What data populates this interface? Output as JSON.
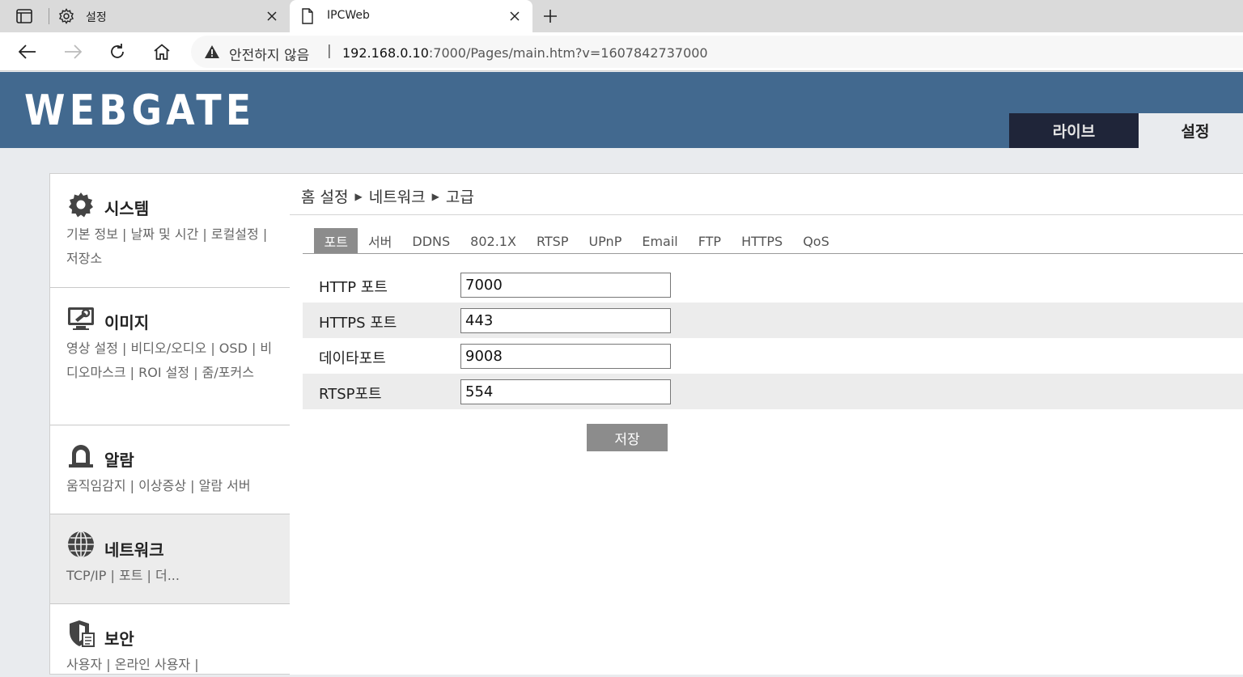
{
  "browser": {
    "tabs": [
      {
        "title": "설정",
        "icon": "gear-icon"
      },
      {
        "title": "IPCWeb",
        "icon": "page-icon"
      }
    ],
    "security_label": "안전하지 않음",
    "separator": "|",
    "url_host": "192.168.0.10",
    "url_rest": ":7000/Pages/main.htm?v=1607842737000"
  },
  "header": {
    "logo": "WEBGATE",
    "tabs": {
      "live": "라이브",
      "setting": "설정"
    },
    "colors": {
      "header_bg": "#42698f",
      "live_tab_bg": "#1f2539"
    }
  },
  "sidebar": {
    "sections": [
      {
        "title": "시스템",
        "icon": "gear-icon",
        "links": "기본 정보 | 날짜 및 시간 | 로컬설정 | 저장소"
      },
      {
        "title": "이미지",
        "icon": "monitor-wrench-icon",
        "links": "영상 설정 | 비디오/오디오 | OSD | 비디오마스크 | ROI 설정 | 줌/포커스"
      },
      {
        "title": "알람",
        "icon": "alarm-light-icon",
        "links": "움직임감지 | 이상증상 | 알람 서버"
      },
      {
        "title": "네트워크",
        "icon": "globe-icon",
        "links": "TCP/IP | 포트 | 더..."
      },
      {
        "title": "보안",
        "icon": "shield-icon",
        "links": "사용자 | 온라인 사용자 |"
      }
    ]
  },
  "main": {
    "breadcrumb": [
      "홈 설정",
      "네트워크",
      "고급"
    ],
    "subtabs": [
      "포트",
      "서버",
      "DDNS",
      "802.1X",
      "RTSP",
      "UPnP",
      "Email",
      "FTP",
      "HTTPS",
      "QoS"
    ],
    "active_subtab": "포트",
    "fields": [
      {
        "label": "HTTP 포트",
        "value": "7000"
      },
      {
        "label": "HTTPS 포트",
        "value": "443"
      },
      {
        "label": "데이타포트",
        "value": "9008"
      },
      {
        "label": "RTSP포트",
        "value": "554"
      }
    ],
    "save_label": "저장"
  }
}
